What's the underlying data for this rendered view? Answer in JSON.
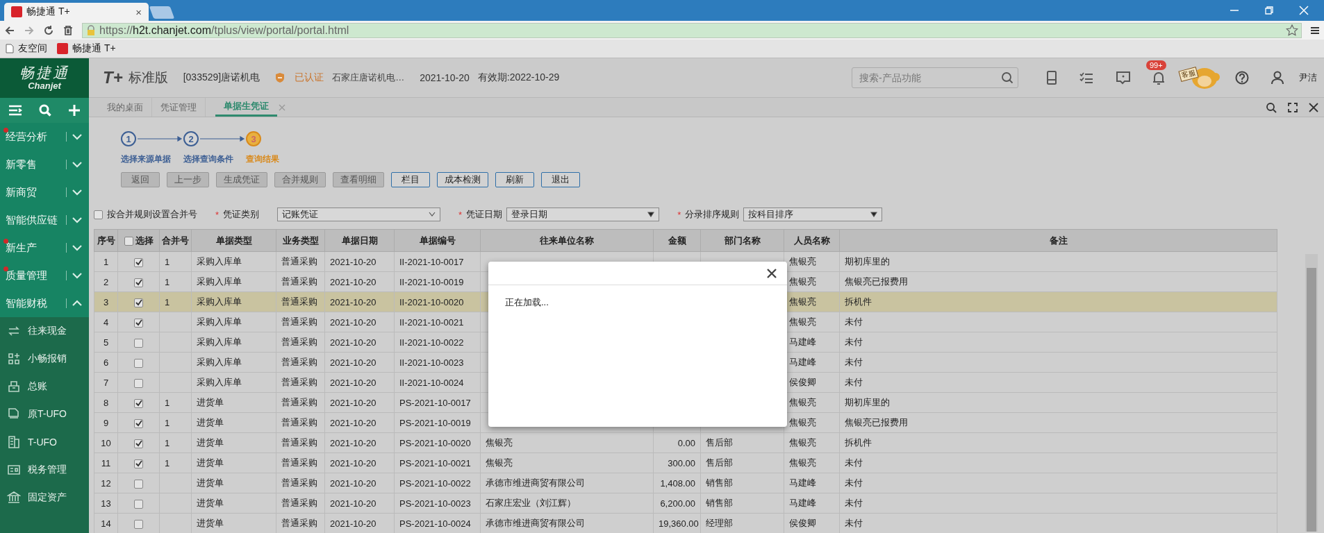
{
  "browser": {
    "tab": {
      "title": "畅捷通 T+",
      "close": "×"
    },
    "url": {
      "scheme": "https://",
      "host": "h2t.chanjet.com",
      "path": "/tplus/view/portal/portal.html"
    },
    "bookmarks": [
      {
        "label": "友空间",
        "kind": "page"
      },
      {
        "label": "畅捷通 T+",
        "kind": "app"
      }
    ]
  },
  "header": {
    "logo": {
      "name": "畅捷通",
      "latin": "Chanjet"
    },
    "product": {
      "mark": "T+",
      "edition": "标准版"
    },
    "account": "[033529]唐诺机电",
    "verified": "已认证",
    "company": "石家庄唐诺机电…",
    "date": "2021-10-20",
    "validity": "有效期:2022-10-29",
    "search": {
      "placeholder": "搜索-产品功能"
    },
    "notification_badge": "99+",
    "service_sign": "客服",
    "user": "尹洁"
  },
  "tabs": [
    {
      "label": "我的桌面",
      "selected": false,
      "closable": false
    },
    {
      "label": "凭证管理",
      "selected": false,
      "closable": false
    },
    {
      "label": "单据生凭证",
      "selected": true,
      "closable": true
    }
  ],
  "sidebar": {
    "items": [
      {
        "label": "经营分析",
        "alert": true,
        "expanded": false
      },
      {
        "label": "新零售",
        "alert": false,
        "expanded": false
      },
      {
        "label": "新商贸",
        "alert": false,
        "expanded": false
      },
      {
        "label": "智能供应链",
        "alert": false,
        "expanded": false
      },
      {
        "label": "新生产",
        "alert": true,
        "expanded": false
      },
      {
        "label": "质量管理",
        "alert": true,
        "expanded": false
      },
      {
        "label": "智能财税",
        "alert": false,
        "expanded": true,
        "children": [
          {
            "label": "往来现金",
            "kind": "swap"
          },
          {
            "label": "小畅报销",
            "kind": "apps"
          },
          {
            "label": "总账",
            "kind": "ledger"
          },
          {
            "label": "原T-UFO",
            "kind": "ufo"
          },
          {
            "label": "T-UFO",
            "kind": "building"
          },
          {
            "label": "税务管理",
            "kind": "tax"
          },
          {
            "label": "固定资产",
            "kind": "bank"
          }
        ]
      }
    ]
  },
  "steps": [
    {
      "number": "1",
      "label": "选择来源单据",
      "selected": false
    },
    {
      "number": "2",
      "label": "选择查询条件",
      "selected": false
    },
    {
      "number": "3",
      "label": "查询结果",
      "selected": true
    }
  ],
  "buttons": [
    {
      "label": "返回",
      "disabled": true
    },
    {
      "label": "上一步",
      "disabled": true
    },
    {
      "label": "生成凭证",
      "disabled": true
    },
    {
      "label": "合并规则",
      "disabled": true
    },
    {
      "label": "查看明细",
      "disabled": true
    },
    {
      "label": "栏目",
      "disabled": false
    },
    {
      "label": "成本检测",
      "disabled": false
    },
    {
      "label": "刷新",
      "disabled": false
    },
    {
      "label": "退出",
      "disabled": false
    }
  ],
  "filters": {
    "merge_by_rule": {
      "label": "按合并规则设置合并号",
      "checked": false
    },
    "fields": [
      {
        "required_mark": "*",
        "label": "凭证类别",
        "value": "记账凭证"
      },
      {
        "required_mark": "*",
        "label": "凭证日期",
        "value": "登录日期"
      },
      {
        "required_mark": "*",
        "label": "分录排序规则",
        "value": "按科目排序"
      }
    ]
  },
  "table": {
    "columns": [
      "序号",
      "选择",
      "合并号",
      "单据类型",
      "业务类型",
      "单据日期",
      "单据编号",
      "往来单位名称",
      "金额",
      "部门名称",
      "人员名称",
      "备注"
    ],
    "rows": [
      {
        "no": "1",
        "checked": true,
        "merge": "1",
        "type": "采购入库单",
        "biz": "普通采购",
        "date": "2021-10-20",
        "code": "II-2021-10-0017",
        "person": "焦银亮",
        "note": "期初库里的",
        "selected": false
      },
      {
        "no": "2",
        "checked": true,
        "merge": "1",
        "type": "采购入库单",
        "biz": "普通采购",
        "date": "2021-10-20",
        "code": "II-2021-10-0019",
        "person": "焦银亮",
        "note": "焦银亮已报费用",
        "selected": false
      },
      {
        "no": "3",
        "checked": true,
        "merge": "1",
        "type": "采购入库单",
        "biz": "普通采购",
        "date": "2021-10-20",
        "code": "II-2021-10-0020",
        "person": "焦银亮",
        "note": "拆机件",
        "selected": true
      },
      {
        "no": "4",
        "checked": true,
        "type": "采购入库单",
        "biz": "普通采购",
        "date": "2021-10-20",
        "code": "II-2021-10-0021",
        "person": "焦银亮",
        "note": "未付",
        "selected": false
      },
      {
        "no": "5",
        "checked": false,
        "type": "采购入库单",
        "biz": "普通采购",
        "date": "2021-10-20",
        "code": "II-2021-10-0022",
        "person": "马建峰",
        "note": "未付",
        "selected": false
      },
      {
        "no": "6",
        "checked": false,
        "type": "采购入库单",
        "biz": "普通采购",
        "date": "2021-10-20",
        "code": "II-2021-10-0023",
        "person": "马建峰",
        "note": "未付",
        "selected": false
      },
      {
        "no": "7",
        "checked": false,
        "type": "采购入库单",
        "biz": "普通采购",
        "date": "2021-10-20",
        "code": "II-2021-10-0024",
        "person": "侯俊卿",
        "note": "未付",
        "selected": false
      },
      {
        "no": "8",
        "checked": true,
        "merge": "1",
        "type": "进货单",
        "biz": "普通采购",
        "date": "2021-10-20",
        "code": "PS-2021-10-0017",
        "person": "焦银亮",
        "note": "期初库里的",
        "selected": false
      },
      {
        "no": "9",
        "checked": true,
        "merge": "1",
        "type": "进货单",
        "biz": "普通采购",
        "date": "2021-10-20",
        "code": "PS-2021-10-0019",
        "person": "焦银亮",
        "note": "焦银亮已报费用",
        "selected": false
      },
      {
        "no": "10",
        "checked": true,
        "merge": "1",
        "type": "进货单",
        "biz": "普通采购",
        "date": "2021-10-20",
        "code": "PS-2021-10-0020",
        "partner": "焦银亮",
        "amount": "0.00",
        "dept": "售后部",
        "person": "焦银亮",
        "note": "拆机件",
        "selected": false
      },
      {
        "no": "11",
        "checked": true,
        "merge": "1",
        "type": "进货单",
        "biz": "普通采购",
        "date": "2021-10-20",
        "code": "PS-2021-10-0021",
        "partner": "焦银亮",
        "amount": "300.00",
        "dept": "售后部",
        "person": "焦银亮",
        "note": "未付",
        "selected": false
      },
      {
        "no": "12",
        "checked": false,
        "type": "进货单",
        "biz": "普通采购",
        "date": "2021-10-20",
        "code": "PS-2021-10-0022",
        "partner": "承德市维进商贸有限公司",
        "amount": "1,408.00",
        "dept": "销售部",
        "person": "马建峰",
        "note": "未付",
        "selected": false
      },
      {
        "no": "13",
        "checked": false,
        "type": "进货单",
        "biz": "普通采购",
        "date": "2021-10-20",
        "code": "PS-2021-10-0023",
        "partner": "石家庄宏业（刘江辉）",
        "amount": "6,200.00",
        "dept": "销售部",
        "person": "马建峰",
        "note": "未付",
        "selected": false
      },
      {
        "no": "14",
        "checked": false,
        "type": "进货单",
        "biz": "普通采购",
        "date": "2021-10-20",
        "code": "PS-2021-10-0024",
        "partner": "承德市维进商贸有限公司",
        "amount": "19,360.00",
        "dept": "经理部",
        "person": "侯俊卿",
        "note": "未付",
        "selected": false
      }
    ]
  },
  "dialog": {
    "message": "正在加载..."
  }
}
